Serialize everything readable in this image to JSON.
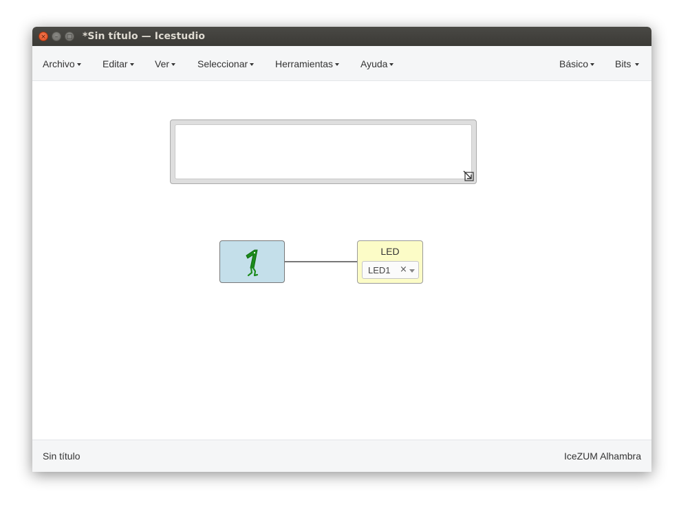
{
  "window": {
    "title": "*Sin título — Icestudio",
    "controls": {
      "close": "×",
      "minimize": "–",
      "maximize": "□"
    }
  },
  "menubar": {
    "left": [
      {
        "label": "Archivo"
      },
      {
        "label": "Editar"
      },
      {
        "label": "Ver"
      },
      {
        "label": "Seleccionar"
      },
      {
        "label": "Herramientas"
      },
      {
        "label": "Ayuda"
      }
    ],
    "right": [
      {
        "label": "Básico"
      },
      {
        "label": "Bits"
      }
    ]
  },
  "canvas": {
    "info_block": {
      "text": ""
    },
    "constant_block": {
      "value_icon": "constant-one-icon",
      "color": "#c4dfea"
    },
    "output_block": {
      "title": "LED",
      "pin_value": "LED1",
      "clear_symbol": "×",
      "color": "#fcfcc7"
    }
  },
  "statusbar": {
    "left": "Sin título",
    "right": "IceZUM Alhambra"
  }
}
